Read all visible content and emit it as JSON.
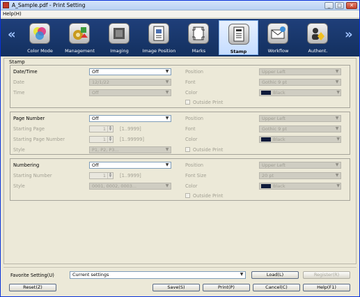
{
  "window": {
    "title": "A_Sample.pdf - Print Setting",
    "controls": [
      "_",
      "□",
      "✕"
    ]
  },
  "menu": {
    "help": "Help(H)"
  },
  "ribbon": {
    "left_arrow": "«",
    "right_arrow": "»",
    "items": [
      {
        "label": "Color Mode",
        "icon": "color-mode-icon",
        "active": false
      },
      {
        "label": "Management",
        "icon": "management-icon",
        "active": false
      },
      {
        "label": "Imaging",
        "icon": "imaging-icon",
        "active": false
      },
      {
        "label": "Image Position",
        "icon": "image-position-icon",
        "active": false
      },
      {
        "label": "Marks",
        "icon": "marks-icon",
        "active": false
      },
      {
        "label": "Stamp",
        "icon": "stamp-icon",
        "active": true
      },
      {
        "label": "Workflow",
        "icon": "workflow-icon",
        "active": false
      },
      {
        "label": "Authent.",
        "icon": "authentication-icon",
        "active": false
      }
    ]
  },
  "panel": {
    "title": "Stamp"
  },
  "datetime": {
    "label": "Date/Time",
    "value": "Off",
    "date_label": "Date",
    "date_value": "12/1/22",
    "time_label": "Time",
    "time_value": "Off",
    "position_label": "Position",
    "position_value": "Upper Left",
    "font_label": "Font",
    "font_value": "Gothic 9 pt",
    "color_label": "Color",
    "color_value": "Black",
    "outside_print": "Outside Print"
  },
  "pagenumber": {
    "label": "Page Number",
    "value": "Off",
    "start_page_label": "Starting Page",
    "start_page_value": "1",
    "start_page_range": "[1..9999]",
    "start_num_label": "Starting Page Number",
    "start_num_value": "1",
    "start_num_range": "[1..99999]",
    "style_label": "Style",
    "style_value": "P1, P2, P3...",
    "position_label": "Position",
    "position_value": "Upper Left",
    "font_label": "Font",
    "font_value": "Gothic 9 pt",
    "color_label": "Color",
    "color_value": "Black",
    "outside_print": "Outside Print"
  },
  "numbering": {
    "label": "Numbering",
    "value": "Off",
    "start_num_label": "Starting Number",
    "start_num_value": "1",
    "start_num_range": "[1..9999]",
    "style_label": "Style",
    "style_value": "0001, 0002, 0003...",
    "position_label": "Position",
    "position_value": "Upper Left",
    "fontsize_label": "Font Size",
    "fontsize_value": "20 pt",
    "color_label": "Color",
    "color_value": "Black",
    "outside_print": "Outside Print"
  },
  "favorite": {
    "label": "Favorite Setting(U)",
    "value": "Current settings",
    "load": "Load(L)",
    "register": "Register(R)"
  },
  "footer": {
    "reset": "Reset(Z)",
    "save": "Save(S)",
    "print": "Print(P)",
    "cancel": "Cancel(C)",
    "help": "Help(F1)"
  },
  "colors": {
    "ribbon": "#1f3f7a",
    "swatch_black": "#0e1a3a"
  }
}
